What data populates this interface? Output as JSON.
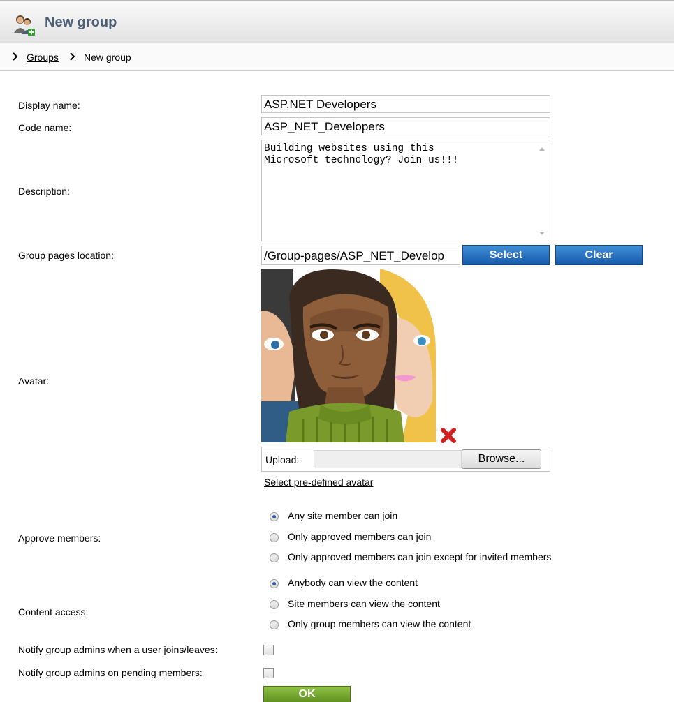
{
  "header": {
    "title": "New group",
    "icon": "group-add-icon"
  },
  "breadcrumb": {
    "parent": "Groups",
    "current": "New group"
  },
  "form": {
    "display_name": {
      "label": "Display name:",
      "value": "ASP.NET Developers"
    },
    "code_name": {
      "label": "Code name:",
      "value": "ASP_NET_Developers"
    },
    "description": {
      "label": "Description:",
      "value": "Building websites using this\nMicrosoft technology? Join us!!!"
    },
    "pages_location": {
      "label": "Group pages location:",
      "value": "/Group-pages/ASP_NET_Develop",
      "select_label": "Select",
      "clear_label": "Clear"
    },
    "avatar": {
      "label": "Avatar:",
      "upload_label": "Upload:",
      "browse_label": "Browse...",
      "predefined_link": "Select pre-defined avatar"
    },
    "approve_members": {
      "label": "Approve members:",
      "options": [
        {
          "label": "Any site member can join",
          "checked": true
        },
        {
          "label": "Only approved members can join",
          "checked": false
        },
        {
          "label": "Only approved members can join except for invited members",
          "checked": false
        }
      ]
    },
    "content_access": {
      "label": "Content access:",
      "options": [
        {
          "label": "Anybody can view the content",
          "checked": true
        },
        {
          "label": "Site members can view the content",
          "checked": false
        },
        {
          "label": "Only group members can view the content",
          "checked": false
        }
      ]
    },
    "notify_join_leave": {
      "label": "Notify group admins when a user joins/leaves:",
      "checked": false
    },
    "notify_pending": {
      "label": "Notify group admins on pending members:",
      "checked": false
    },
    "ok_label": "OK"
  },
  "colors": {
    "title": "#4b5f7a",
    "blue_button": "#1f6cc0",
    "ok_button": "#6f9f2a",
    "delete_icon": "#d22020"
  }
}
